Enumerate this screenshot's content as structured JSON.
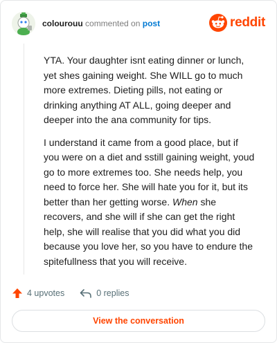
{
  "comment": {
    "author": "colourouu",
    "action_text": "commented on",
    "post_link_label": "post",
    "paragraphs": [
      {
        "text": "YTA. Your daughter isnt eating dinner or lunch, yet shes gaining weight. She WILL go to much more extremes. Dieting pills, not eating or drinking anything AT ALL, going deeper and deeper into the ana community for tips."
      },
      {
        "before": "I understand it came from a good place, but if you were on a diet and sstill gaining weight, youd go to more extremes too. She needs help, you need to force her. She will hate you for it, but its better than her getting worse.",
        "emphasis": "When",
        "after": "she recovers, and she will if she can get the right help, she will realise that you did what you did because you love her, so you have to endure the spitefullness that you will receive."
      }
    ],
    "upvotes_label": "4 upvotes",
    "replies_label": "0 replies"
  },
  "brand": {
    "wordmark": "reddit",
    "icon": "reddit-snoo-icon",
    "color": "#ff4500"
  },
  "cta": {
    "label": "View the conversation"
  },
  "colors": {
    "accent": "#ff4500",
    "link": "#0079d3",
    "muted": "#576f76"
  }
}
